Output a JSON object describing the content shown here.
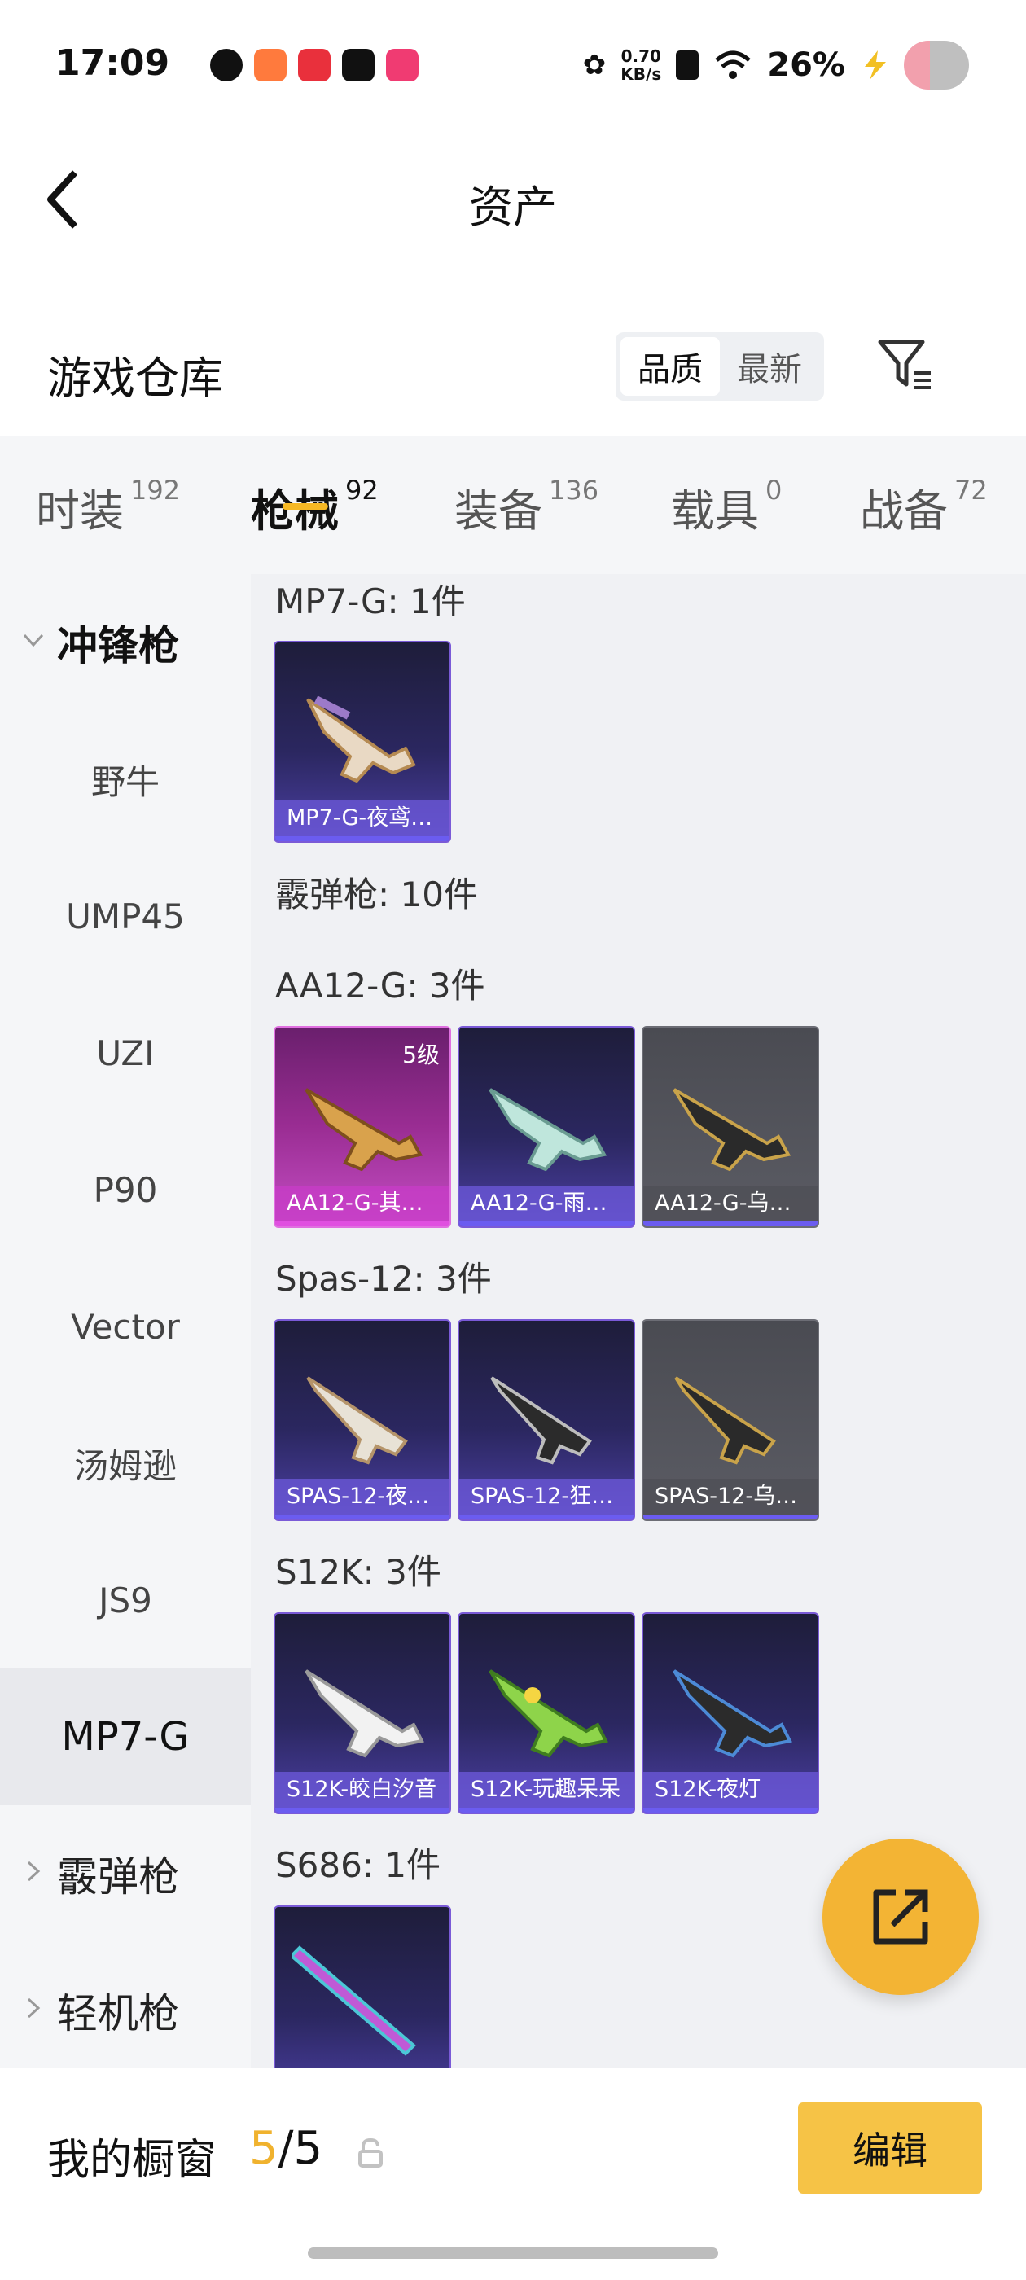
{
  "status_bar": {
    "time": "17:09",
    "speed_value": "0.70",
    "speed_unit": "KB/s",
    "battery": "26%"
  },
  "header": {
    "title": "资产"
  },
  "warehouse": {
    "title": "游戏仓库",
    "sort_options": [
      "品质",
      "最新"
    ],
    "sort_active": "品质"
  },
  "tabs": [
    {
      "label": "时装",
      "count": "192"
    },
    {
      "label": "枪械",
      "count": "92"
    },
    {
      "label": "装备",
      "count": "136"
    },
    {
      "label": "载具",
      "count": "0"
    },
    {
      "label": "战备",
      "count": "72"
    }
  ],
  "sidebar": {
    "items": [
      {
        "label": "冲锋枪"
      },
      {
        "label": "野牛"
      },
      {
        "label": "UMP45"
      },
      {
        "label": "UZI"
      },
      {
        "label": "P90"
      },
      {
        "label": "Vector"
      },
      {
        "label": "汤姆逊"
      },
      {
        "label": "JS9"
      },
      {
        "label": "MP7-G"
      },
      {
        "label": "霰弹枪"
      },
      {
        "label": "轻机枪"
      }
    ]
  },
  "content": {
    "groups": [
      {
        "label": "MP7-G: 1件"
      },
      {
        "label": "霰弹枪: 10件"
      },
      {
        "label": "AA12-G: 3件"
      },
      {
        "label": "Spas-12: 3件"
      },
      {
        "label": "S12K: 3件"
      },
      {
        "label": "S686: 1件"
      }
    ],
    "cards": [
      {
        "name": "MP7-G-夜鸢…"
      },
      {
        "name": "AA12-G-其…",
        "level": "5级"
      },
      {
        "name": "AA12-G-雨…"
      },
      {
        "name": "AA12-G-乌…"
      },
      {
        "name": "SPAS-12-夜…"
      },
      {
        "name": "SPAS-12-狂…"
      },
      {
        "name": "SPAS-12-乌…"
      },
      {
        "name": "S12K-皎白汐音"
      },
      {
        "name": "S12K-玩趣呆呆"
      },
      {
        "name": "S12K-夜灯"
      }
    ]
  },
  "showcase": {
    "label": "我的橱窗",
    "current": "5",
    "separator": "/",
    "total": "5",
    "edit_label": "编辑"
  },
  "colors": {
    "accent": "#f6c346",
    "tab_indicator": "#f6b824",
    "rarity_purple": "#6b5cf0",
    "rarity_pink": "#e050e0"
  }
}
